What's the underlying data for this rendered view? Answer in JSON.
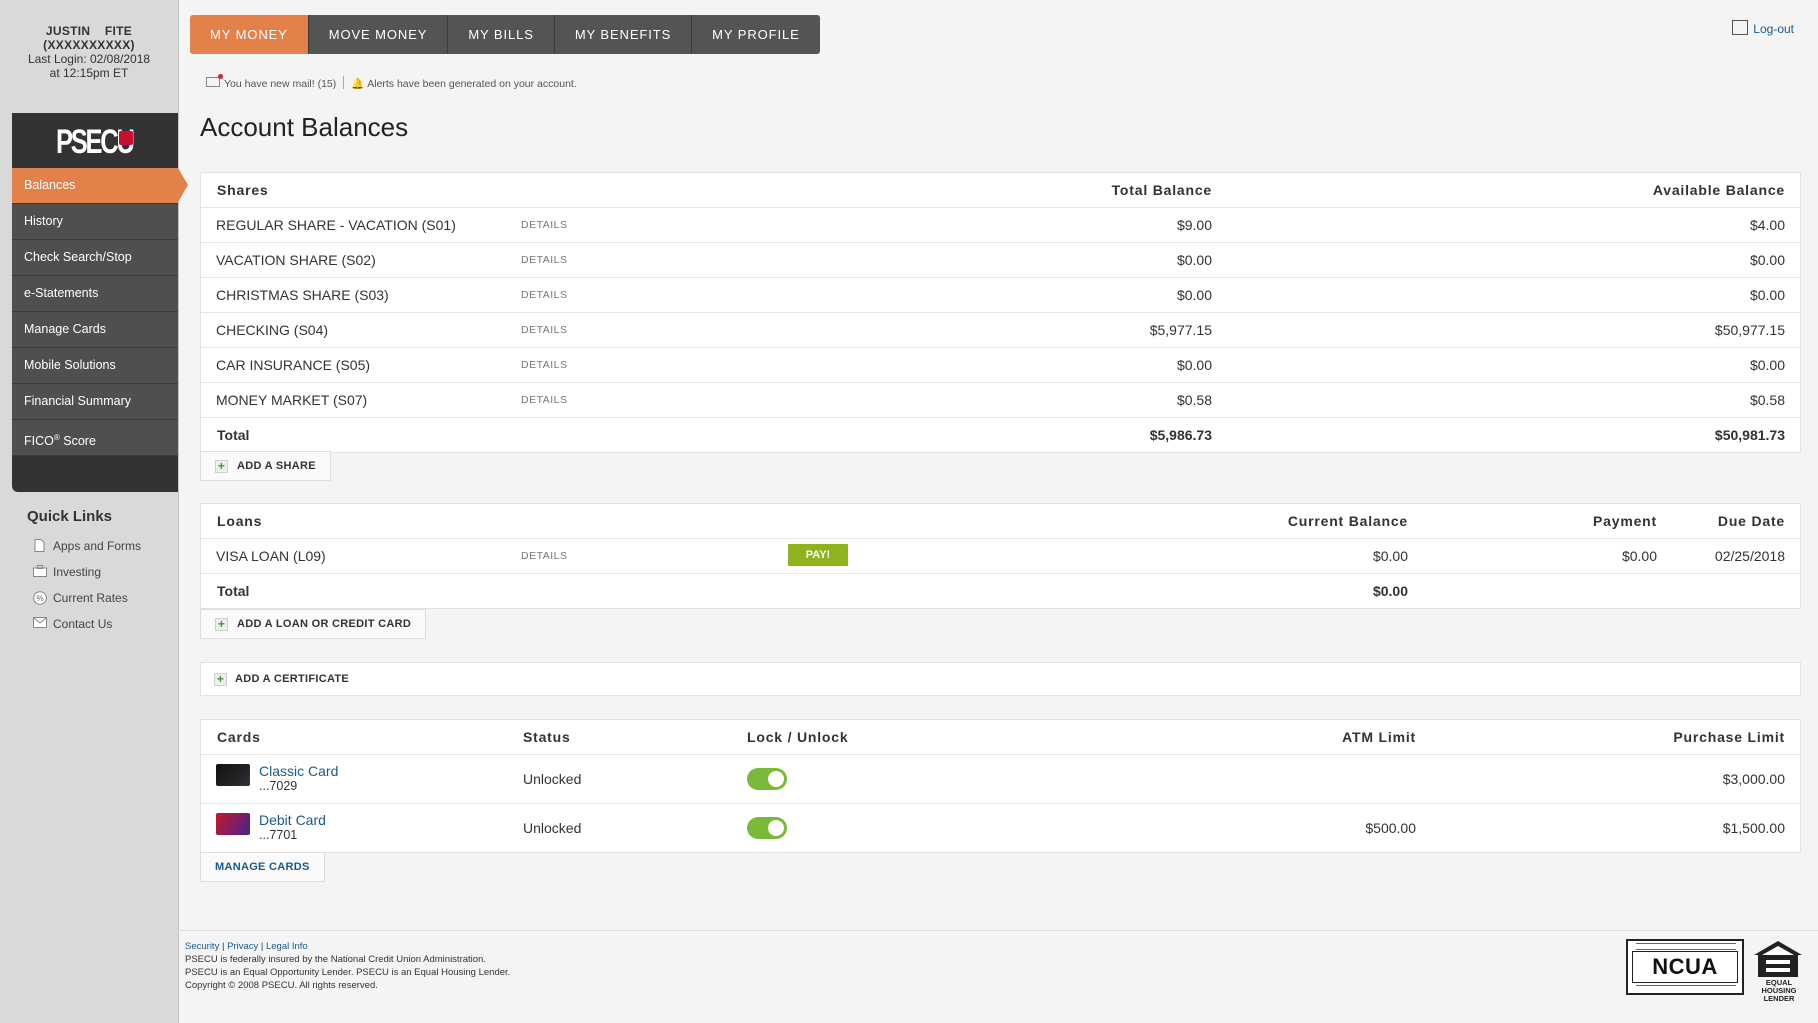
{
  "user": {
    "name": "JUSTIN    FITE",
    "account_masked": "(XXXXXXXXXX)",
    "last_login": "Last Login: 02/08/2018",
    "last_login_time": "at 12:15pm ET"
  },
  "brand": {
    "logo_text": "PSECU"
  },
  "sidebar": {
    "items": [
      {
        "label": "Balances"
      },
      {
        "label": "History"
      },
      {
        "label": "Check Search/Stop"
      },
      {
        "label": "e-Statements"
      },
      {
        "label": "Manage Cards"
      },
      {
        "label": "Mobile Solutions"
      },
      {
        "label": "Financial Summary"
      },
      {
        "label": "FICO",
        "sup": "®",
        "suffix": " Score"
      }
    ]
  },
  "quick_links": {
    "title": "Quick Links",
    "items": [
      {
        "label": "Apps and Forms",
        "icon": "document-icon"
      },
      {
        "label": "Investing",
        "icon": "briefcase-icon"
      },
      {
        "label": "Current Rates",
        "icon": "percent-icon"
      },
      {
        "label": "Contact Us",
        "icon": "envelope-icon"
      }
    ]
  },
  "topnav": {
    "tabs": [
      {
        "label": "MY MONEY"
      },
      {
        "label": "MOVE MONEY"
      },
      {
        "label": "MY BILLS"
      },
      {
        "label": "MY BENEFITS"
      },
      {
        "label": "MY PROFILE"
      }
    ],
    "logout": "Log-out"
  },
  "alerts": {
    "mail": "You have new mail! (15)",
    "alerts": "Alerts have been generated on your account."
  },
  "page_title": "Account Balances",
  "shares": {
    "headers": {
      "name": "Shares",
      "total": "Total Balance",
      "available": "Available Balance"
    },
    "details_label": "DETAILS",
    "rows": [
      {
        "name": "REGULAR SHARE - VACATION (S01)",
        "total": "$9.00",
        "available": "$4.00"
      },
      {
        "name": "VACATION SHARE (S02)",
        "total": "$0.00",
        "available": "$0.00"
      },
      {
        "name": "CHRISTMAS SHARE (S03)",
        "total": "$0.00",
        "available": "$0.00"
      },
      {
        "name": "CHECKING (S04)",
        "total": "$5,977.15",
        "available": "$50,977.15"
      },
      {
        "name": "CAR INSURANCE (S05)",
        "total": "$0.00",
        "available": "$0.00"
      },
      {
        "name": "MONEY MARKET (S07)",
        "total": "$0.58",
        "available": "$0.58"
      }
    ],
    "total": {
      "label": "Total",
      "total": "$5,986.73",
      "available": "$50,981.73"
    },
    "add_label": "ADD A SHARE"
  },
  "loans": {
    "headers": {
      "name": "Loans",
      "current": "Current Balance",
      "payment": "Payment",
      "due": "Due Date"
    },
    "rows": [
      {
        "name": "VISA LOAN (L09)",
        "details": "DETAILS",
        "pay": "PAY!",
        "current": "$0.00",
        "payment": "$0.00",
        "due": "02/25/2018"
      }
    ],
    "total": {
      "label": "Total",
      "current": "$0.00"
    },
    "add_label": "ADD A LOAN OR CREDIT CARD"
  },
  "certificates": {
    "add_label": "ADD A CERTIFICATE"
  },
  "cards": {
    "headers": {
      "name": "Cards",
      "status": "Status",
      "lock": "Lock / Unlock",
      "atm": "ATM Limit",
      "purchase": "Purchase Limit"
    },
    "rows": [
      {
        "name": "Classic Card",
        "number": "...7029",
        "status": "Unlocked",
        "atm": "",
        "purchase": "$3,000.00",
        "unlocked": true
      },
      {
        "name": "Debit Card",
        "number": "...7701",
        "status": "Unlocked",
        "atm": "$500.00",
        "purchase": "$1,500.00",
        "unlocked": true
      }
    ],
    "manage_label": "MANAGE CARDS"
  },
  "footer": {
    "links": [
      "Security",
      "Privacy",
      "Legal Info"
    ],
    "line1": "PSECU is federally insured by the National Credit Union Administration.",
    "line2": "PSECU is an Equal Opportunity Lender. PSECU is an Equal Housing Lender.",
    "line3": "Copyright © 2008 PSECU. All rights reserved.",
    "ncua": "NCUA",
    "ehl": "EQUAL HOUSING LENDER"
  },
  "colors": {
    "accent_orange": "#e2814a",
    "nav_dark": "#4f4f4f",
    "link_blue": "#1a5a8a",
    "pay_green": "#8fb31d",
    "toggle_green": "#7aba3a"
  }
}
